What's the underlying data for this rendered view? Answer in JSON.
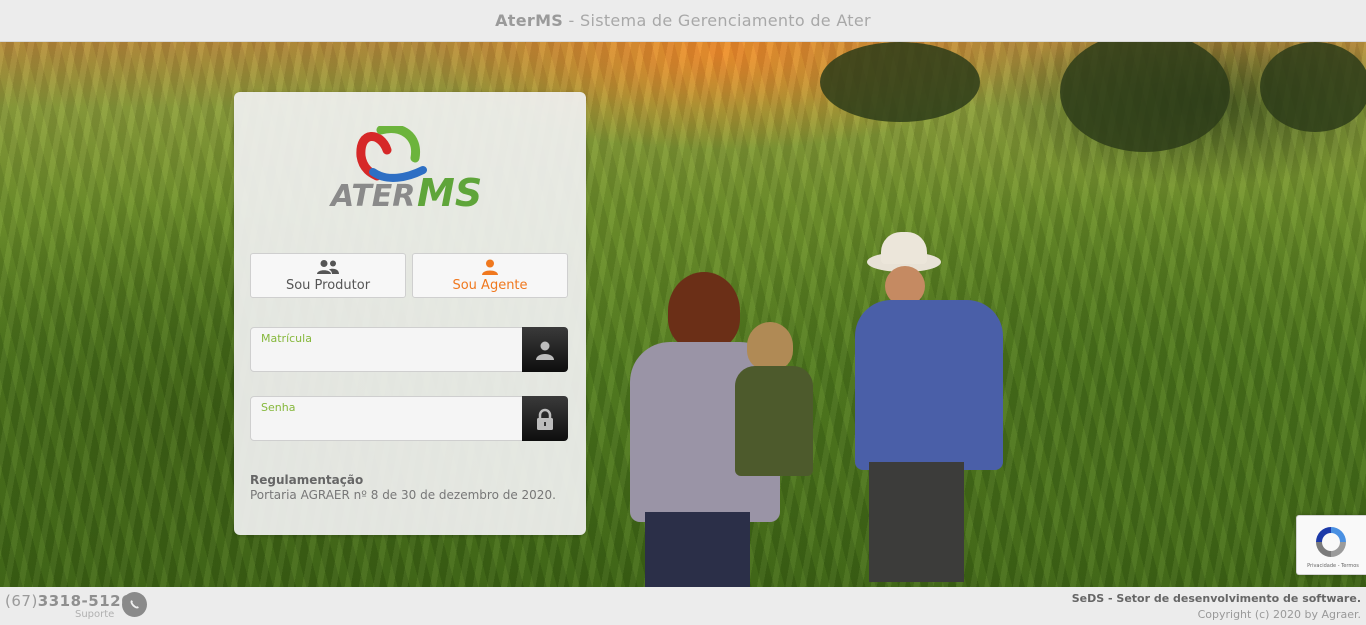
{
  "header": {
    "brand": "AterMS",
    "separator": " - ",
    "subtitle": "Sistema de Gerenciamento de Ater"
  },
  "logo": {
    "text_left": "ATER",
    "text_right": "MS"
  },
  "roles": {
    "produtor_label": "Sou Produtor",
    "agente_label": "Sou Agente",
    "active": "agente",
    "active_color": "#f0781e"
  },
  "form": {
    "matricula_label": "Matrícula",
    "matricula_value": "",
    "senha_label": "Senha",
    "senha_value": "",
    "label_color": "#86b83c"
  },
  "regulation": {
    "title": "Regulamentação",
    "text": "Portaria AGRAER nº 8 de 30 de dezembro de 2020."
  },
  "recaptcha": {
    "text": "Privacidade - Termos"
  },
  "footer": {
    "phone_area": "(67)",
    "phone_number": "3318-5126",
    "phone_sub": "Suporte",
    "credits_line1": "SeDS - Setor de desenvolvimento de software.",
    "credits_line2": "Copyright (c) 2020 by Agraer."
  },
  "icons": {
    "produtor": "users-icon",
    "agente": "user-icon",
    "matricula": "user-icon",
    "senha": "lock-icon",
    "support": "whatsapp-icon"
  }
}
